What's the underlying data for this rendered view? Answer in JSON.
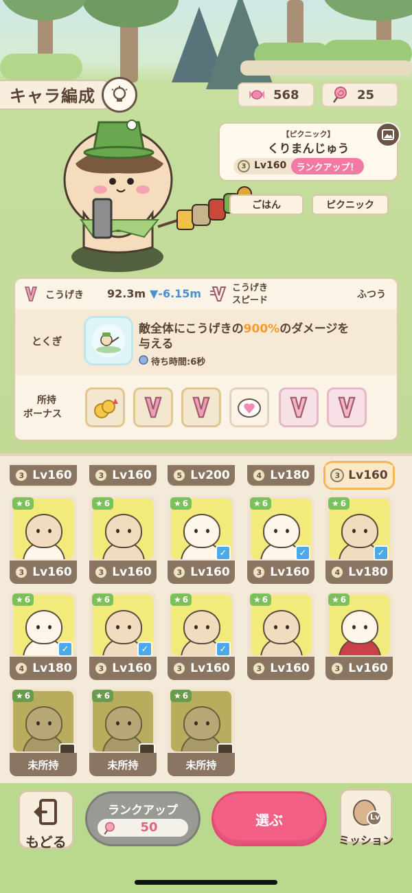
{
  "header": {
    "title": "キャラ編成",
    "currencies": {
      "candy": "568",
      "lollipop": "25"
    }
  },
  "character": {
    "event_tag": "【ピクニック】",
    "name": "くりまんじゅう",
    "rank": "3",
    "level": "Lv160",
    "rankup_label": "ランクアップ！",
    "tags": [
      "ごはん",
      "ピクニック"
    ]
  },
  "stats": {
    "attack_label": "こうげき",
    "attack_value": "92.3m",
    "attack_delta": "▼-6.15m",
    "speed_label_1": "こうげき",
    "speed_label_2": "スピード",
    "speed_value": "ふつう",
    "skill_label": "とくぎ",
    "skill_text_1": "敵全体にこうげきの",
    "skill_highlight": "900%",
    "skill_text_2": "のダメージを",
    "skill_text_3": "与える",
    "wait_time": "待ち時間:6秒",
    "bonus_label_1": "所持",
    "bonus_label_2": "ボーナス"
  },
  "roster": {
    "top_row": [
      {
        "rank": "3",
        "level": "Lv160"
      },
      {
        "rank": "3",
        "level": "Lv160"
      },
      {
        "rank": "5",
        "level": "Lv200"
      },
      {
        "rank": "4",
        "level": "Lv180"
      },
      {
        "rank": "3",
        "level": "Lv160"
      }
    ],
    "row2": [
      {
        "stars": "6",
        "rank": "3",
        "level": "Lv160",
        "checked": false
      },
      {
        "stars": "6",
        "rank": "3",
        "level": "Lv160",
        "checked": false
      },
      {
        "stars": "6",
        "rank": "3",
        "level": "Lv160",
        "checked": true
      },
      {
        "stars": "6",
        "rank": "3",
        "level": "Lv160",
        "checked": true
      },
      {
        "stars": "6",
        "rank": "4",
        "level": "Lv180",
        "checked": true
      }
    ],
    "row3": [
      {
        "stars": "6",
        "rank": "4",
        "level": "Lv180",
        "checked": true
      },
      {
        "stars": "6",
        "rank": "3",
        "level": "Lv160",
        "checked": true
      },
      {
        "stars": "6",
        "rank": "3",
        "level": "Lv160",
        "checked": true
      },
      {
        "stars": "6",
        "rank": "3",
        "level": "Lv160",
        "checked": false
      },
      {
        "stars": "6",
        "rank": "3",
        "level": "Lv160",
        "checked": false
      }
    ],
    "row4": [
      {
        "stars": "6",
        "status": "未所持"
      },
      {
        "stars": "6",
        "status": "未所持"
      },
      {
        "stars": "6",
        "status": "未所持"
      }
    ]
  },
  "bottom": {
    "back_label": "もどる",
    "rankup_label": "ランクアップ",
    "rankup_cost": "50",
    "select_label": "選ぶ",
    "mission_label": "ミッション",
    "mission_icon_text": "Lv"
  },
  "colors": {
    "accent_pink": "#f45f86",
    "card_yellow": "#f2ea7a",
    "check_blue": "#4aa9e6",
    "star_green": "#7cc05c"
  }
}
